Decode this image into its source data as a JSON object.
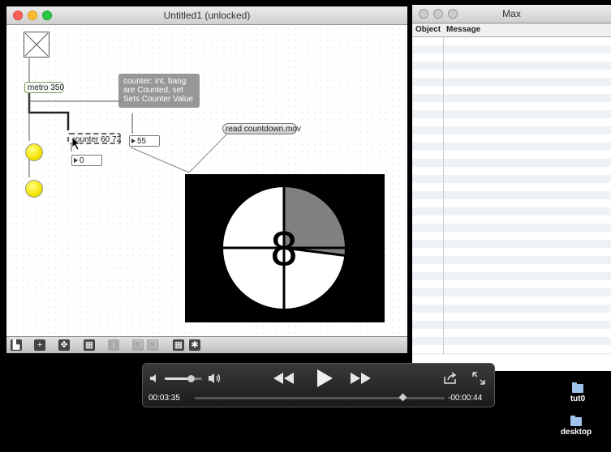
{
  "patcher": {
    "title": "Untitled1 (unlocked)",
    "objects": {
      "metro": "metro 350",
      "counter": "counter 60 72",
      "read_msg": "read countdown.mov",
      "number_55": "55",
      "number_0": "0"
    },
    "tooltip": "counter: int, bang are Counted, set Sets Counter Value"
  },
  "movie": {
    "digit": "8",
    "progress_fraction": 0.27
  },
  "max_window": {
    "title": "Max",
    "columns": [
      "Object",
      "Message"
    ]
  },
  "controller": {
    "elapsed": "00:03:35",
    "remaining": "-00:00:44",
    "volume_fraction": 0.7,
    "scrub_fraction": 0.83
  },
  "desktop": {
    "icons": [
      {
        "label": "tut0"
      },
      {
        "label": "desktop"
      }
    ]
  },
  "colors": {
    "led": "#f4e400",
    "titlebar": "#d8d8d8",
    "close": "#ff5f57",
    "minimize": "#febc2e",
    "zoom": "#28c840"
  }
}
